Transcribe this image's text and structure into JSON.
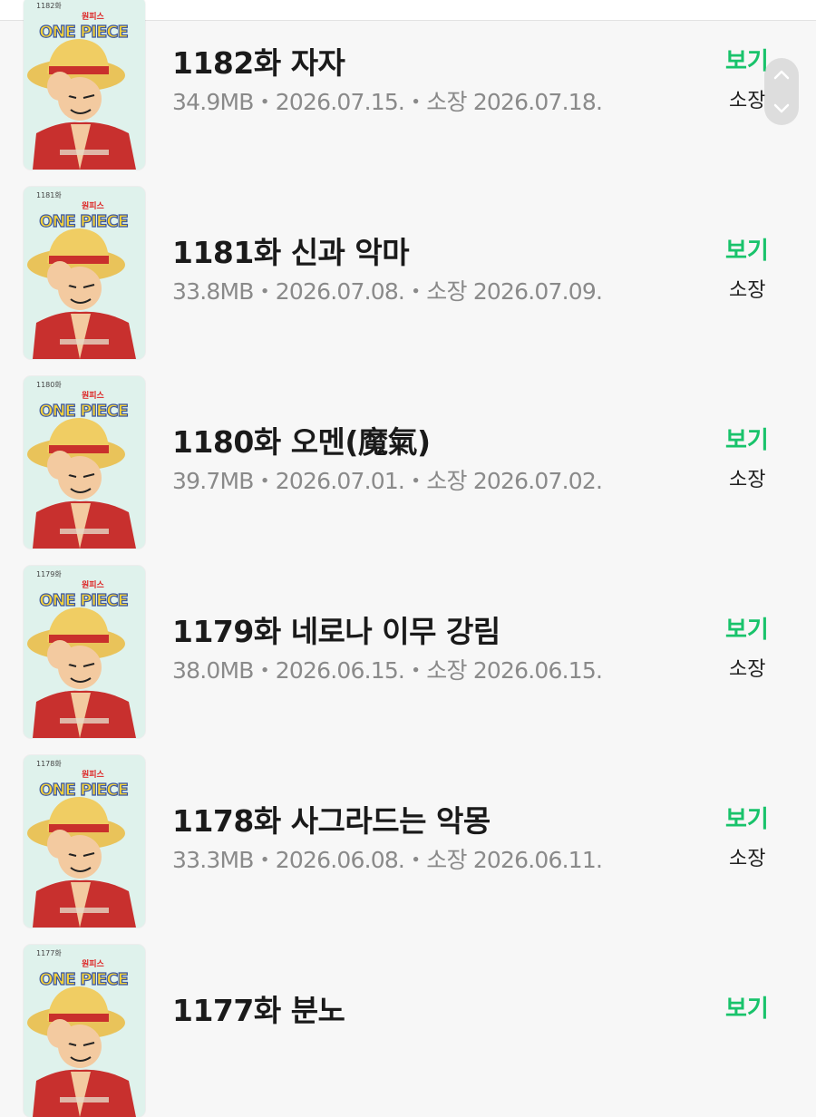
{
  "episodes": [
    {
      "cover_label": "1182화",
      "cover_small": "원피스",
      "title": "1182화 자자",
      "meta": "34.9MB・2026.07.15.・소장 2026.07.18.",
      "view_label": "보기",
      "owned_label": "소장"
    },
    {
      "cover_label": "1181화",
      "cover_small": "원피스",
      "title": "1181화 신과 악마",
      "meta": "33.8MB・2026.07.08.・소장 2026.07.09.",
      "view_label": "보기",
      "owned_label": "소장"
    },
    {
      "cover_label": "1180화",
      "cover_small": "원피스",
      "title": "1180화 오멘(魔氣)",
      "meta": "39.7MB・2026.07.01.・소장 2026.07.02.",
      "view_label": "보기",
      "owned_label": "소장"
    },
    {
      "cover_label": "1179화",
      "cover_small": "원피스",
      "title": "1179화 네로나 이무 강림",
      "meta": "38.0MB・2026.06.15.・소장 2026.06.15.",
      "view_label": "보기",
      "owned_label": "소장"
    },
    {
      "cover_label": "1178화",
      "cover_small": "원피스",
      "title": "1178화 사그라드는 악몽",
      "meta": "33.3MB・2026.06.08.・소장 2026.06.11.",
      "view_label": "보기",
      "owned_label": "소장"
    },
    {
      "cover_label": "1177화",
      "cover_small": "원피스",
      "title": "1177화 분노",
      "meta": "",
      "view_label": "보기",
      "owned_label": ""
    }
  ],
  "cover_logo": "ONE PIECE",
  "colors": {
    "accent_green": "#19c36b",
    "title_text": "#1a1a1a",
    "meta_text": "#8a8a8a",
    "background": "#f7f7f7",
    "cover_bg": "#dff2ec"
  },
  "icons": {
    "scroll_up": "chevron-up-icon",
    "scroll_down": "chevron-down-icon"
  }
}
